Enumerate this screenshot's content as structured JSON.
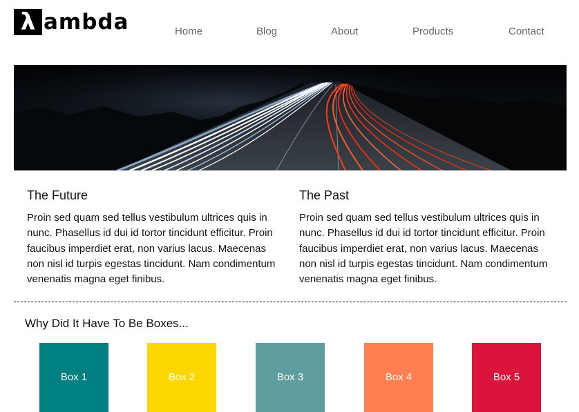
{
  "brand": {
    "mark": "λ",
    "text": "ambda"
  },
  "nav": {
    "items": [
      {
        "label": "Home"
      },
      {
        "label": "Blog"
      },
      {
        "label": "About"
      },
      {
        "label": "Products"
      },
      {
        "label": "Contact"
      }
    ]
  },
  "hero": {
    "image": "long-exposure-highway-light-trails-image"
  },
  "sections": [
    {
      "title": "The Future",
      "body": "Proin sed quam sed tellus vestibulum ultrices quis in nunc. Phasellus id dui id tortor tincidunt efficitur. Proin faucibus imperdiet erat, non varius lacus. Maecenas non nisl id turpis egestas tincidunt. Nam condimentum venenatis magna eget finibus."
    },
    {
      "title": "The Past",
      "body": "Proin sed quam sed tellus vestibulum ultrices quis in nunc. Phasellus id dui id tortor tincidunt efficitur. Proin faucibus imperdiet erat, non varius lacus. Maecenas non nisl id turpis egestas tincidunt. Nam condimentum venenatis magna eget finibus."
    }
  ],
  "boxes": {
    "title": "Why Did It Have To Be Boxes...",
    "items": [
      {
        "label": "Box 1",
        "color": "#008080"
      },
      {
        "label": "Box 2",
        "color": "#FFD700"
      },
      {
        "label": "Box 3",
        "color": "#5F9EA0"
      },
      {
        "label": "Box 4",
        "color": "#FF7F50"
      },
      {
        "label": "Box 5",
        "color": "#DC143C"
      }
    ]
  }
}
